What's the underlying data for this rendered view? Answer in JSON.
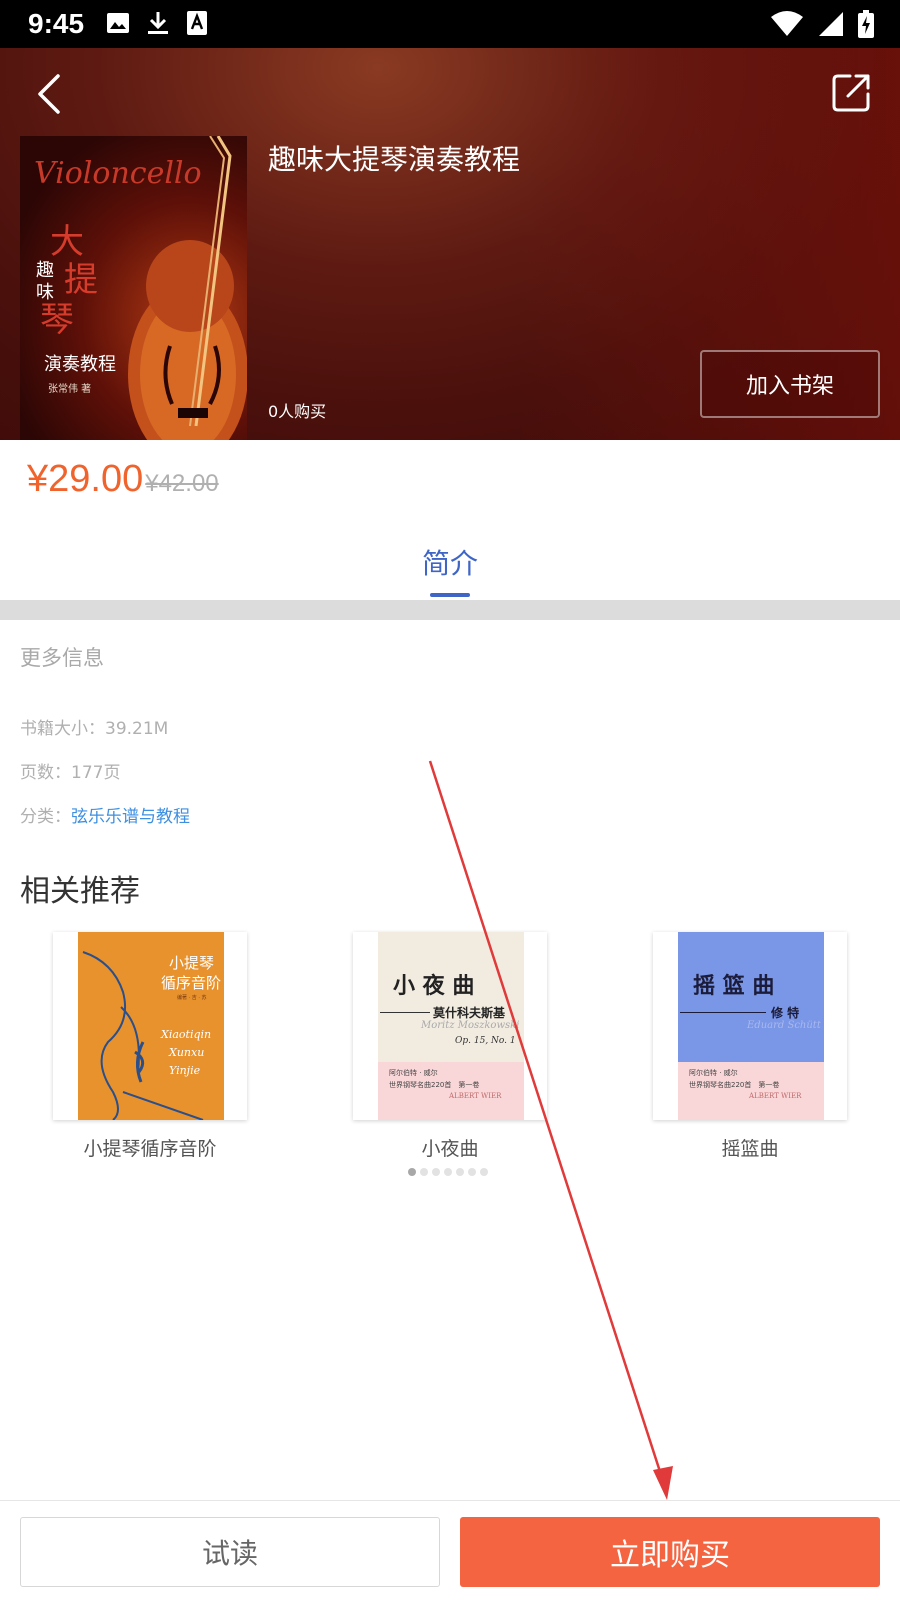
{
  "status_bar": {
    "time": "9:45",
    "left_icons": [
      "image-icon",
      "download-icon",
      "text-a-icon"
    ],
    "right_icons": [
      "wifi-icon",
      "signal-icon",
      "battery-charging-icon"
    ]
  },
  "header": {
    "book_title": "趣味大提琴演奏教程",
    "buyers": "0人购买",
    "add_to_shelf": "加入书架",
    "cover": {
      "script_title": "Violoncello",
      "big_chars": [
        "大",
        "提",
        "琴"
      ],
      "small_chars": [
        "趣",
        "味"
      ],
      "subtitle": "演奏教程",
      "author": "张常伟 著"
    }
  },
  "price": {
    "current": "¥29.00",
    "original": "¥42.00",
    "current_color": "#f0632c"
  },
  "tabs": [
    {
      "label": "简介",
      "active": true
    }
  ],
  "info": {
    "section_title": "更多信息",
    "size_label": "书籍大小：",
    "size_value": "39.21M",
    "pages_label": "页数：",
    "pages_value": "177页",
    "category_label": "分类：",
    "category_value": "弦乐乐谱与教程"
  },
  "recommend": {
    "title": "相关推荐",
    "items": [
      {
        "label": "小提琴循序音阶",
        "cover_title_1": "小提琴",
        "cover_title_2": "循序音阶",
        "cover_script": [
          "Xiaotiqin",
          "Xunxu",
          "Yinjie"
        ],
        "cover_author": "编著 · 吉 · 苏"
      },
      {
        "label": "小夜曲",
        "cover_title": "小 夜 曲",
        "cover_composer_cn": "莫什科夫斯基",
        "cover_composer_en": "Moritz Moszkowski",
        "cover_op": "Op. 15, No. 1",
        "cover_series_cn": "阿尔伯特 · 威尔",
        "cover_series_desc": "世界钢琴名曲220首　第一卷",
        "cover_series_en": "ALBERT WIER"
      },
      {
        "label": "摇篮曲",
        "cover_title": "摇 篮 曲",
        "cover_composer_cn": "修 特",
        "cover_composer_en": "Eduard Schütt",
        "cover_series_cn": "阿尔伯特 · 威尔",
        "cover_series_desc": "世界钢琴名曲220首　第一卷",
        "cover_series_en": "ALBERT WIER"
      }
    ],
    "pager_count": 7,
    "pager_active": 0
  },
  "bottom": {
    "try_read": "试读",
    "buy_now": "立即购买",
    "buy_color": "#f56441"
  },
  "annotation": {
    "color": "#e03a3a"
  }
}
